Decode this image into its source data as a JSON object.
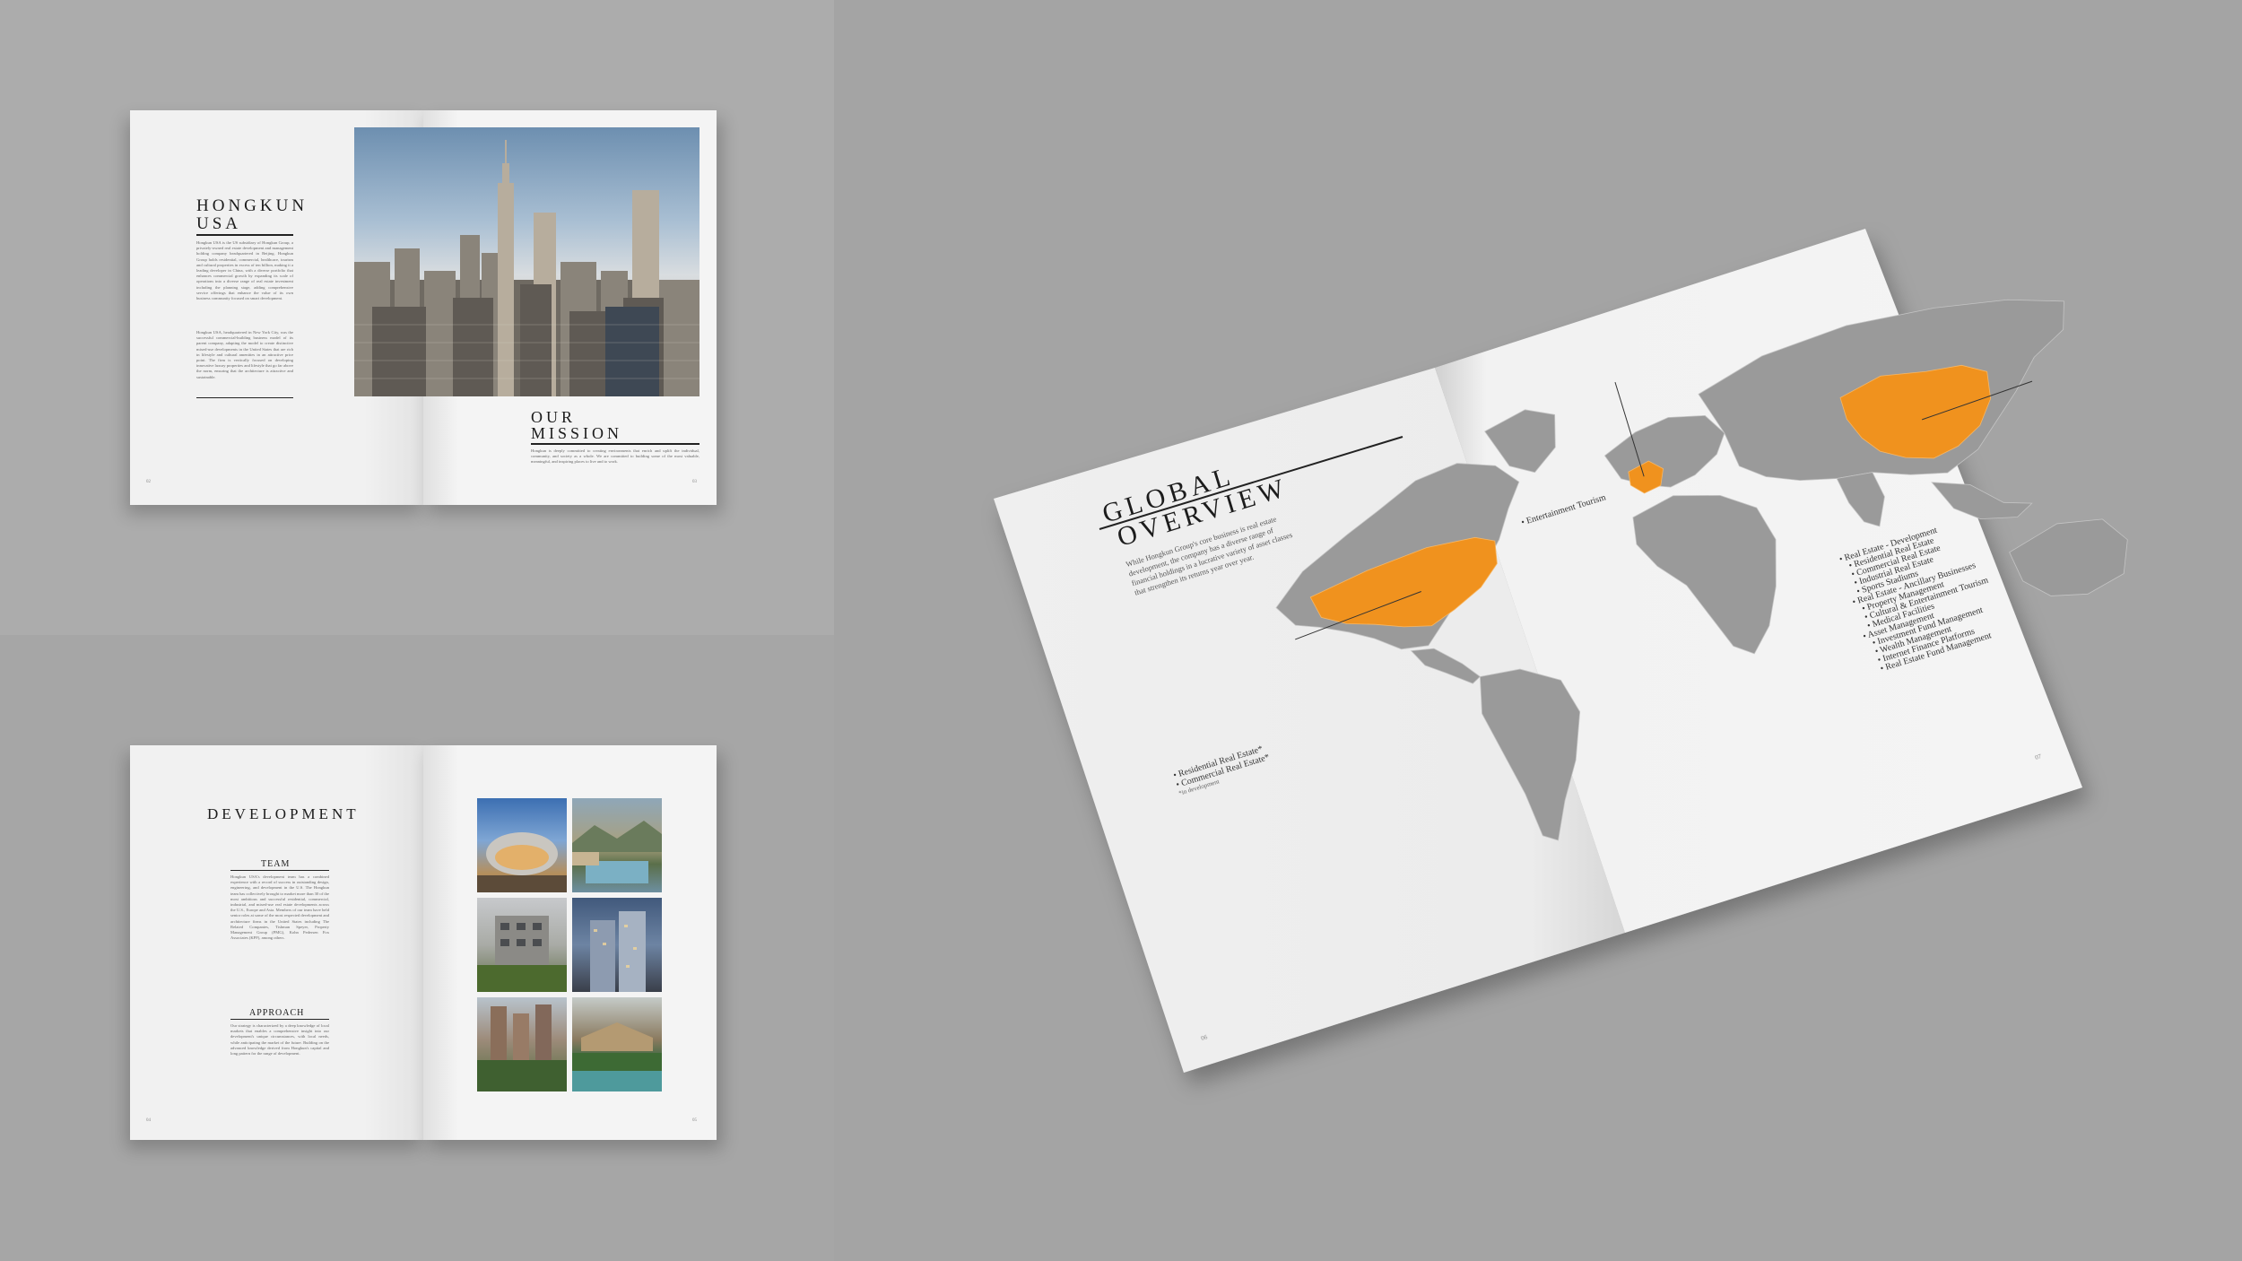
{
  "spread_hongkun": {
    "title_line1": "HONGKUN",
    "title_line2": "USA",
    "body_p1": "Hongkun USA is the US subsidiary of Hongkun Group, a privately-owned real estate development and management holding company headquartered in Beijing. Hongkun Group holds residential, commercial, healthcare, tourism and cultural properties in excess of ten billion, making it a leading developer in China, with a diverse portfolio that enhances commercial growth by expanding its scale of operations into a diverse range of real estate investment including the planning stage, adding comprehensive service offerings that enhance the value of its own business community focused on smart development.",
    "body_p2": "Hongkun USA, headquartered in New York City, was the successful commercial-building business model of its parent company, adapting the model to create distinctive mixed-use developments in the United States that are rich in lifestyle and cultural amenities in an attractive price point. The firm is vertically focused on developing innovative luxury properties and lifestyle that go far above the norm, ensuring that the architecture is attractive and sustainable.",
    "mission_line1": "OUR",
    "mission_line2": "MISSION",
    "mission_text": "Hongkun is deeply committed to creating environments that enrich and uplift the individual, community, and society as a whole. We are committed to building some of the most valuable, meaningful, and inspiring places to live and to work.",
    "page_left": "02",
    "page_right": "03"
  },
  "spread_development": {
    "title": "DEVELOPMENT",
    "team_heading": "TEAM",
    "team_text": "Hongkun USA's development team has a combined experience with a record of success in outstanding design, engineering, and development in the U.S. The Hongkun team has collectively brought to market more than 30 of the most ambitious and successful residential, commercial, industrial, and mixed-use real estate developments across the U.S., Europe and Asia. Members of our team have held senior roles at some of the most respected development and architecture firms in the United States including The Related Companies, Tishman Speyer, Property Management Group (PMG), Kohn Pedersen Fox Associates (KPF), among others.",
    "approach_heading": "APPROACH",
    "approach_text": "Our strategy is characterized by a deep knowledge of local markets that enables a comprehensive insight into our development's unique circumstances, with local needs, while anticipating the market of the future. Building on the advanced knowledge derived from Hongkun's capital and long pattern for the range of development.",
    "page_left": "04",
    "page_right": "05"
  },
  "spread_global": {
    "title_line1": "GLOBAL",
    "title_line2": "OVERVIEW",
    "intro": "While Hongkun Group's core business is real estate development, the company has a diverse range of financial holdings in a lucrative variety of asset classes that strengthen its returns year over year.",
    "europe_label": "• Entertainment Tourism",
    "us_labels": [
      "• Residential Real Estate*",
      "• Commercial Real Estate*",
      "*in development"
    ],
    "china_labels": [
      "• Real Estate - Development",
      "• Residential Real Estate",
      "• Commercial Real Estate",
      "• Industrial Real Estate",
      "• Sports Stadiums",
      "• Real Estate - Ancillary Businesses",
      "• Property Management",
      "• Cultural & Entertainment Tourism",
      "• Medical Facilities",
      "• Asset Management",
      "• Investment Fund Management",
      "• Wealth Management",
      "• Internet Finance Platforms",
      "• Real Estate Fund Management"
    ],
    "highlight_color": "#f0921e",
    "land_color": "#9a9a9a",
    "page_left": "06",
    "page_right": "07"
  }
}
